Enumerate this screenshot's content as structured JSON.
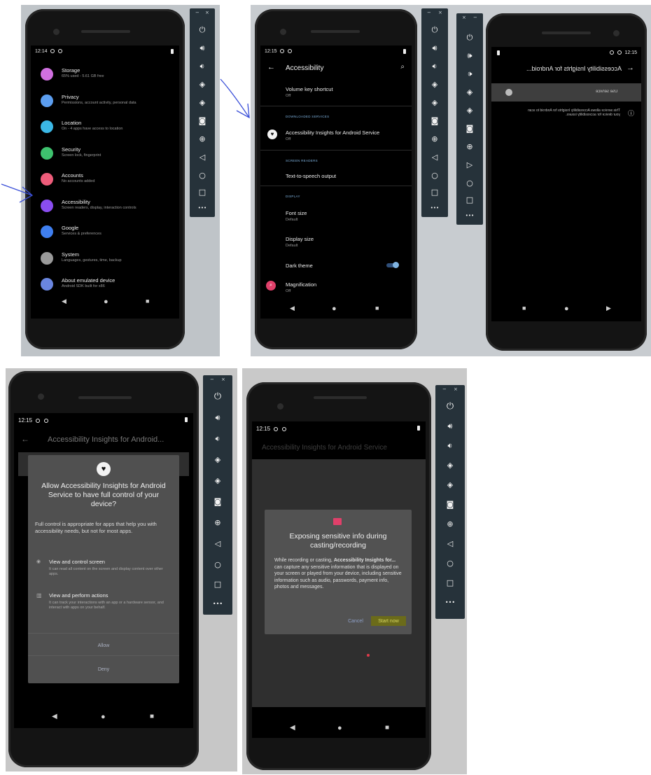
{
  "panel1": {
    "time": "12:14",
    "items": [
      {
        "title": "Storage",
        "sub": "65% used - 5.61 GB free",
        "color": "#d070e0"
      },
      {
        "title": "Privacy",
        "sub": "Permissions, account activity, personal data",
        "color": "#5c9ef0"
      },
      {
        "title": "Location",
        "sub": "On - 4 apps have access to location",
        "color": "#3bb8e6"
      },
      {
        "title": "Security",
        "sub": "Screen lock, fingerprint",
        "color": "#3ec26e"
      },
      {
        "title": "Accounts",
        "sub": "No accounts added",
        "color": "#ee5c7a"
      },
      {
        "title": "Accessibility",
        "sub": "Screen readers, display, interaction controls",
        "color": "#8a4df0"
      },
      {
        "title": "Google",
        "sub": "Services & preferences",
        "color": "#3f7ff0"
      },
      {
        "title": "System",
        "sub": "Languages, gestures, time, backup",
        "color": "#9a9a9a"
      },
      {
        "title": "About emulated device",
        "sub": "Android SDK built for x86",
        "color": "#6a86e0"
      }
    ]
  },
  "panel2": {
    "time": "12:15",
    "title": "Accessibility",
    "volume_key_title": "Volume key shortcut",
    "volume_key_sub": "Off",
    "section_downloaded": "DOWNLOADED SERVICES",
    "service_title": "Accessibility Insights for Android Service",
    "service_sub": "Off",
    "section_screen_readers": "SCREEN READERS",
    "tts_title": "Text-to-speech output",
    "section_display": "DISPLAY",
    "font_size_title": "Font size",
    "font_size_sub": "Default",
    "display_size_title": "Display size",
    "display_size_sub": "Default",
    "dark_theme_title": "Dark theme",
    "magnification_title": "Magnification",
    "magnification_sub": "Off"
  },
  "panel3": {
    "time": "12:15",
    "title": "Accessibility Insights for Android...",
    "use_service_label": "Use service",
    "description": "This service allows Accessibility Insights for Android to scan your device for accessibility issues."
  },
  "panel4": {
    "time": "12:15",
    "title": "Accessibility Insights for Android...",
    "dialog_heading": "Allow Accessibility Insights for Android Service to have full control of your device?",
    "dialog_body": "Full control is appropriate for apps that help you with accessibility needs, but not for most apps.",
    "perm1_title": "View and control screen",
    "perm1_desc": "It can read all content on the screen and display content over other apps.",
    "perm2_title": "View and perform actions",
    "perm2_desc": "It can track your interactions with an app or a hardware sensor, and interact with apps on your behalf.",
    "allow_label": "Allow",
    "deny_label": "Deny"
  },
  "panel5": {
    "time": "12:15",
    "title": "Accessibility Insights for Android Service",
    "dialog_heading": "Exposing sensitive info during casting/recording",
    "body_prefix": "While recording or casting, ",
    "body_app": "Accessibility Insights for...",
    "body_rest": " can capture any sensitive information that is displayed on your screen or played from your device, including sensitive information such as audio, passwords, payment info, photos and messages.",
    "cancel_label": "Cancel",
    "start_label": "Start now",
    "highlight_color": "#c8c820"
  },
  "emulator_toolbar": {
    "window_min": "−",
    "window_close": "×",
    "more": "•••"
  },
  "nav": {
    "back": "◀",
    "home": "●",
    "recents": "■"
  }
}
